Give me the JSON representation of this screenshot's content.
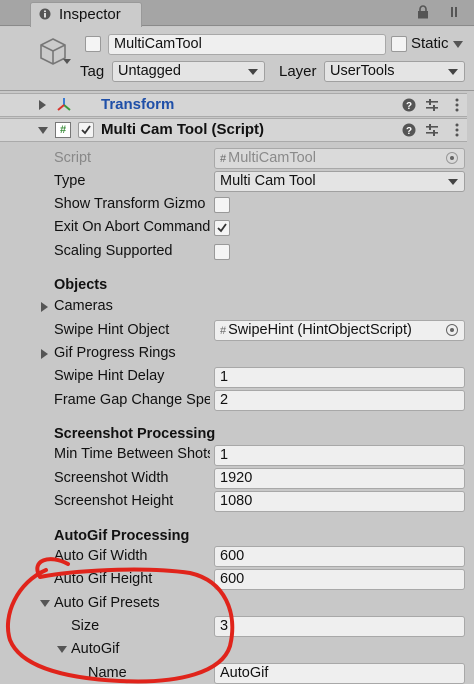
{
  "tab": {
    "title": "Inspector"
  },
  "header": {
    "object_name": "MultiCamTool",
    "static_label": "Static",
    "tag_label": "Tag",
    "tag_value": "Untagged",
    "layer_label": "Layer",
    "layer_value": "UserTools"
  },
  "transform": {
    "title": "Transform"
  },
  "component": {
    "title": "Multi Cam Tool (Script)",
    "script_label": "Script",
    "script_value": "MultiCamTool",
    "type_label": "Type",
    "type_value": "Multi Cam Tool",
    "show_gizmo_label": "Show Transform Gizmo",
    "exit_abort_label": "Exit On Abort Command",
    "scaling_label": "Scaling Supported"
  },
  "objects": {
    "heading": "Objects",
    "cameras_label": "Cameras",
    "swipe_hint_label": "Swipe Hint Object",
    "swipe_hint_value": "SwipeHint (HintObjectScript)",
    "gif_rings_label": "Gif Progress Rings",
    "swipe_delay_label": "Swipe Hint Delay",
    "swipe_delay_value": "1",
    "frame_gap_label": "Frame Gap Change Speed",
    "frame_gap_value": "2"
  },
  "screenshot": {
    "heading": "Screenshot Processing",
    "min_time_label": "Min Time Between Shots",
    "min_time_value": "1",
    "width_label": "Screenshot Width",
    "width_value": "1920",
    "height_label": "Screenshot Height",
    "height_value": "1080"
  },
  "autogif": {
    "heading": "AutoGif Processing",
    "width_label": "Auto Gif Width",
    "width_value": "600",
    "height_label": "Auto Gif Height",
    "height_value": "600",
    "presets_label": "Auto Gif Presets",
    "size_label": "Size",
    "size_value": "3",
    "element_label": "AutoGif",
    "name_label": "Name",
    "name_value": "AutoGif"
  },
  "colors": {
    "annotation": "#e0241b",
    "transform_title": "#1f4fa8"
  }
}
